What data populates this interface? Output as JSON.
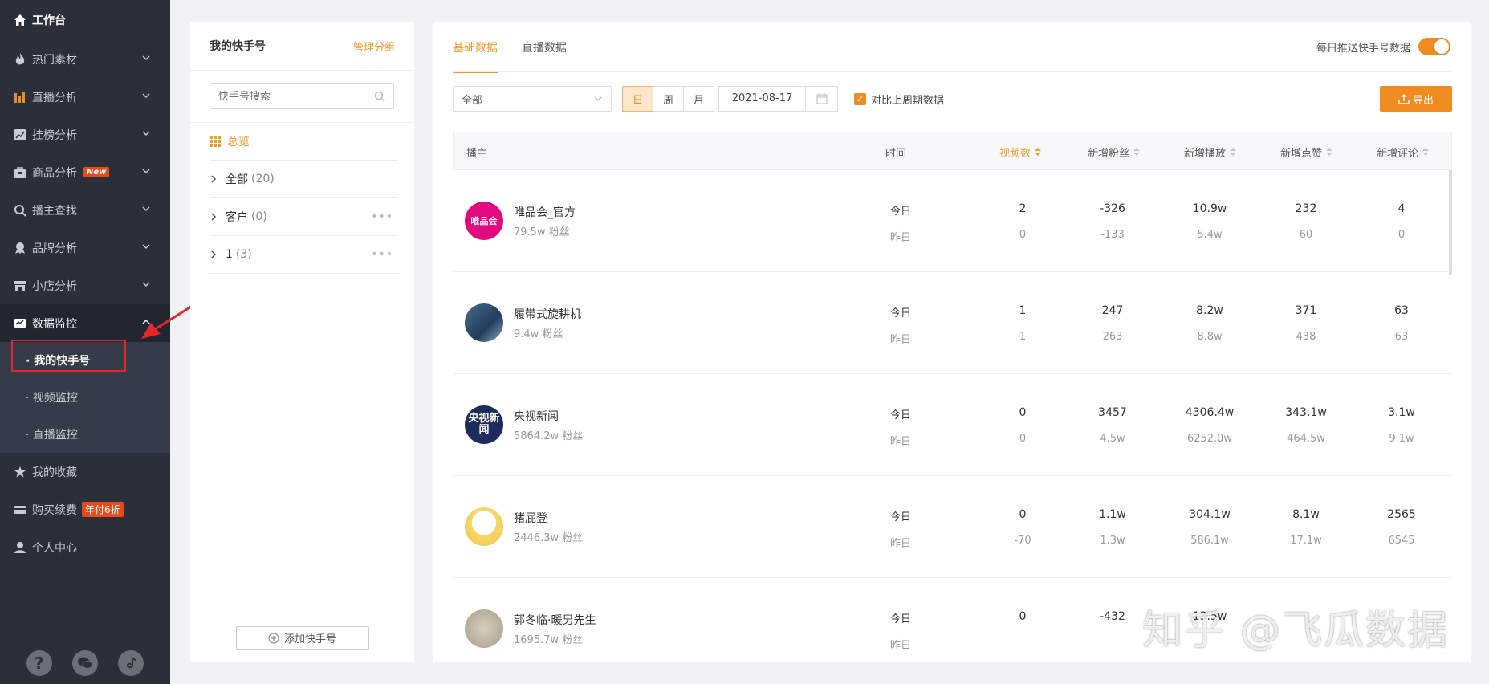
{
  "sidebar": {
    "items": [
      {
        "label": "工作台",
        "icon": "home-icon"
      },
      {
        "label": "热门素材",
        "icon": "fire-icon"
      },
      {
        "label": "直播分析",
        "icon": "bar-chart-icon"
      },
      {
        "label": "挂榜分析",
        "icon": "line-chart-icon"
      },
      {
        "label": "商品分析",
        "icon": "bag-icon",
        "badge": "New"
      },
      {
        "label": "播主查找",
        "icon": "search-icon"
      },
      {
        "label": "品牌分析",
        "icon": "medal-icon"
      },
      {
        "label": "小店分析",
        "icon": "shop-icon"
      },
      {
        "label": "数据监控",
        "icon": "monitor-icon"
      }
    ],
    "submenu": [
      "· 我的快手号",
      "· 视频监控",
      "· 直播监控"
    ],
    "items2": [
      {
        "label": "我的收藏",
        "icon": "star-icon"
      },
      {
        "label": "购买续费",
        "icon": "card-icon",
        "badge": "年付6折"
      },
      {
        "label": "个人中心",
        "icon": "user-icon"
      }
    ]
  },
  "mid": {
    "title": "我的快手号",
    "manage": "管理分组",
    "search_placeholder": "快手号搜索",
    "overview": "总览",
    "groups": [
      {
        "name": "全部",
        "count": "(20)"
      },
      {
        "name": "客户",
        "count": "(0)"
      },
      {
        "name": "1",
        "count": "(3)"
      }
    ],
    "add_btn": "添加快手号"
  },
  "main": {
    "tabs": [
      "基础数据",
      "直播数据"
    ],
    "push_label": "每日推送快手号数据",
    "filter_value": "全部",
    "periods": [
      "日",
      "周",
      "月"
    ],
    "date": "2021-08-17",
    "compare_label": "对比上周期数据",
    "export": "导出",
    "columns": [
      "播主",
      "时间",
      "视频数",
      "新增粉丝",
      "新增播放",
      "新增点赞",
      "新增评论"
    ],
    "day_labels": [
      "今日",
      "昨日"
    ],
    "rows": [
      {
        "name": "唯品会_官方",
        "fans": "79.5w 粉丝",
        "avatar_text": "唯品会",
        "today": [
          "2",
          "-326",
          "10.9w",
          "232",
          "4"
        ],
        "yesterday": [
          "0",
          "-133",
          "5.4w",
          "60",
          "0"
        ]
      },
      {
        "name": "履带式旋耕机",
        "fans": "9.4w 粉丝",
        "avatar_text": "",
        "today": [
          "1",
          "247",
          "8.2w",
          "371",
          "63"
        ],
        "yesterday": [
          "1",
          "263",
          "8.8w",
          "438",
          "63"
        ]
      },
      {
        "name": "央视新闻",
        "fans": "5864.2w 粉丝",
        "avatar_text": "央视新闻",
        "today": [
          "0",
          "3457",
          "4306.4w",
          "343.1w",
          "3.1w"
        ],
        "yesterday": [
          "0",
          "4.5w",
          "6252.0w",
          "464.5w",
          "9.1w"
        ]
      },
      {
        "name": "猪屁登",
        "fans": "2446.3w 粉丝",
        "avatar_text": "",
        "today": [
          "0",
          "1.1w",
          "304.1w",
          "8.1w",
          "2565"
        ],
        "yesterday": [
          "-70",
          "1.3w",
          "586.1w",
          "17.1w",
          "6545"
        ]
      },
      {
        "name": "郭冬临·暖男先生",
        "fans": "1695.7w 粉丝",
        "avatar_text": "",
        "today": [
          "0",
          "-432",
          "13.5w",
          "",
          ""
        ],
        "yesterday": [
          "",
          "",
          "",
          "",
          ""
        ]
      }
    ]
  },
  "watermark": "知乎 @飞瓜数据",
  "colors": {
    "accent": "#f08c1f",
    "sidebar": "#2a2f3a",
    "highlight": "#e5262c"
  }
}
